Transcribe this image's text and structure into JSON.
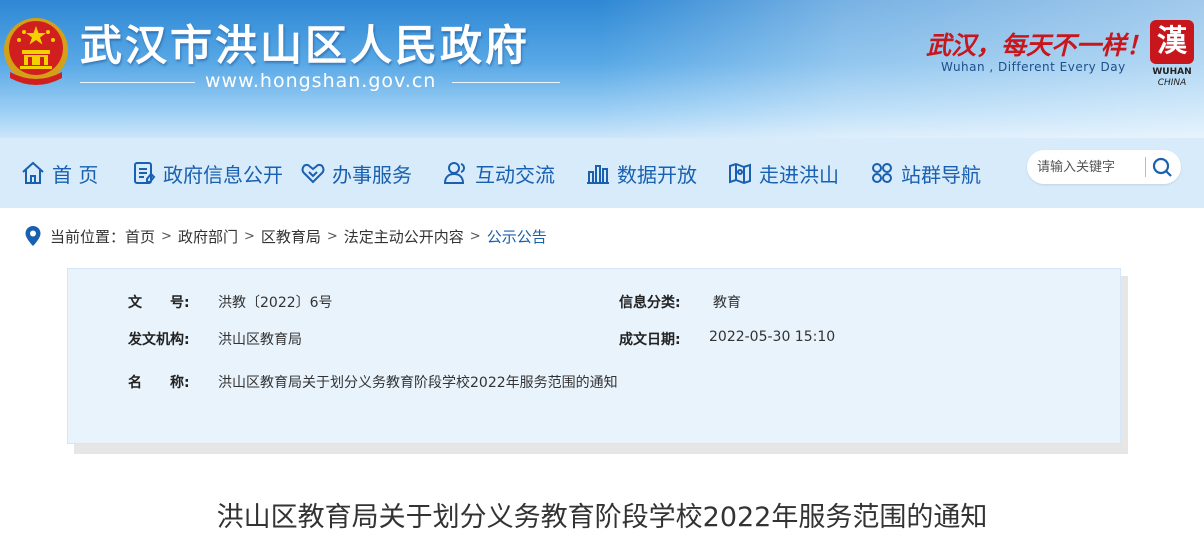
{
  "header": {
    "site_title": "武汉市洪山区人民政府",
    "site_url": "www.hongshan.gov.cn",
    "slogan": "武汉，每天不一样！",
    "slogan_en": "Wuhan , Different Every Day",
    "wuhan_logo_char": "漢",
    "wuhan_logo_text1": "WUHAN",
    "wuhan_logo_text2": "CHINA",
    "colors": {
      "header_blue": "#2f88d4",
      "slogan_red": "#c8161d",
      "nav_text": "#1a60b0"
    }
  },
  "nav": {
    "items": [
      {
        "label": "首 页",
        "icon": "home-icon"
      },
      {
        "label": "政府信息公开",
        "icon": "document-list-icon"
      },
      {
        "label": "办事服务",
        "icon": "handshake-icon"
      },
      {
        "label": "互动交流",
        "icon": "users-icon"
      },
      {
        "label": "数据开放",
        "icon": "bar-chart-icon"
      },
      {
        "label": "走进洪山",
        "icon": "map-icon"
      },
      {
        "label": "站群导航",
        "icon": "grid-nodes-icon"
      }
    ],
    "search_placeholder": "请输入关键字"
  },
  "breadcrumb": {
    "prefix": "当前位置：",
    "items": [
      "首页",
      "政府部门",
      "区教育局",
      "法定主动公开内容",
      "公示公告"
    ],
    "separator": ">"
  },
  "info": {
    "doc_no_label": "文　　号:",
    "doc_no": "洪教〔2022〕6号",
    "category_label": "信息分类:",
    "category": "教育",
    "issuer_label": "发文机构:",
    "issuer": "洪山区教育局",
    "date_label": "成文日期:",
    "date": "2022-05-30 15:10",
    "name_label": "名　　称:",
    "name": "洪山区教育局关于划分义务教育阶段学校2022年服务范围的通知"
  },
  "document": {
    "title": "洪山区教育局关于划分义务教育阶段学校2022年服务范围的通知"
  }
}
